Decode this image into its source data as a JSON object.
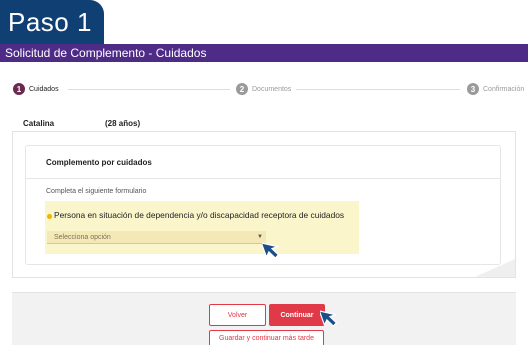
{
  "header": {
    "paso_label": "Paso 1",
    "form_title": "Solicitud de Complemento - Cuidados"
  },
  "stepper": {
    "steps": [
      {
        "number": "1",
        "label": "Cuidados",
        "active": true
      },
      {
        "number": "2",
        "label": "Documentos",
        "active": false
      },
      {
        "number": "3",
        "label": "Confirmación",
        "active": false
      }
    ]
  },
  "person": {
    "name": "Catalina",
    "age": "(28 años)"
  },
  "form": {
    "section_title": "Complemento por cuidados",
    "hint": "Completa el siguiente formulario",
    "question": "Persona en situación de dependencia y/o discapacidad receptora de cuidados",
    "select_placeholder": "Selecciona opción"
  },
  "footer": {
    "back_label": "Volver",
    "continue_label": "Continuar",
    "save_later_label": "Guardar y continuar más tarde"
  },
  "colors": {
    "header_blue": "#0f3f73",
    "title_purple": "#4e2b87",
    "accent_red": "#e03a48",
    "highlight_yellow": "#fbf5cc",
    "cursor_blue": "#1c4f8a"
  },
  "icons": [
    "chevron-down-icon",
    "mouse-cursor-icon"
  ]
}
